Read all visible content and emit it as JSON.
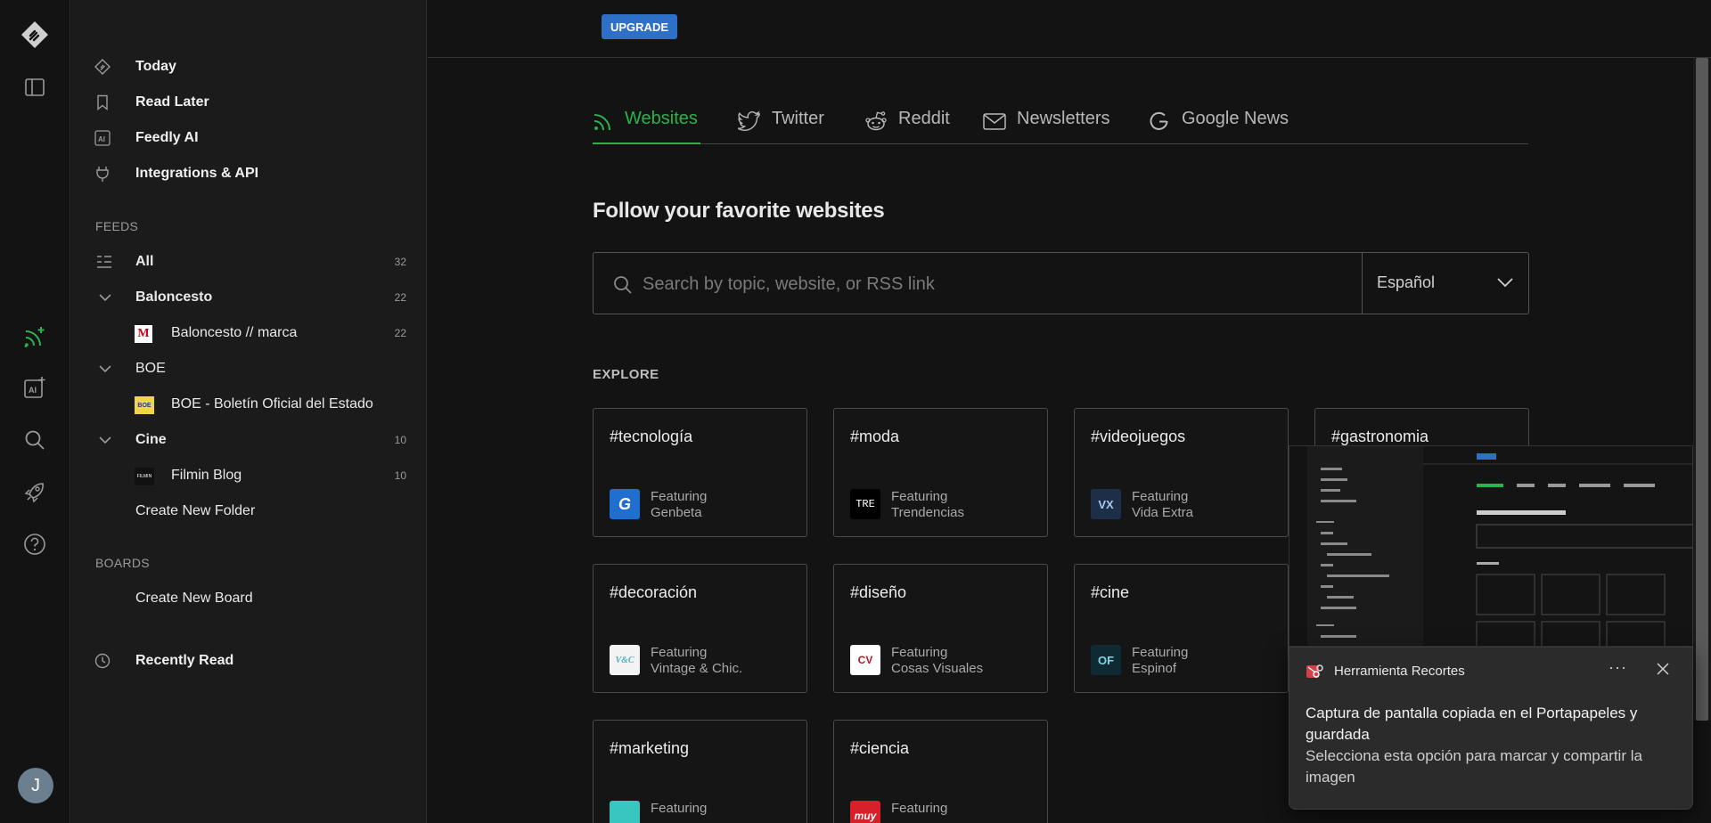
{
  "sidebar": {
    "nav": [
      {
        "label": "Today",
        "icon": "today-icon"
      },
      {
        "label": "Read Later",
        "icon": "bookmark-icon"
      },
      {
        "label": "Feedly AI",
        "icon": "ai-icon"
      },
      {
        "label": "Integrations & API",
        "icon": "plug-icon"
      }
    ],
    "feeds_heading": "FEEDS",
    "all": {
      "label": "All",
      "count": "32"
    },
    "folders": [
      {
        "label": "Baloncesto",
        "count": "22",
        "feed": {
          "label": "Baloncesto // marca",
          "count": "22",
          "icon": "M"
        }
      },
      {
        "label": "BOE",
        "count": "",
        "feed": {
          "label": "BOE - Boletín Oficial del Estado",
          "count": "",
          "icon": "BOE"
        }
      },
      {
        "label": "Cine",
        "count": "10",
        "feed": {
          "label": "Filmin Blog",
          "count": "10",
          "icon": "FILMIN"
        }
      }
    ],
    "create_folder": "Create New Folder",
    "boards_heading": "BOARDS",
    "create_board": "Create New Board",
    "recently_read": "Recently Read"
  },
  "rail": {
    "avatar_letter": "J"
  },
  "topbar": {
    "upgrade": "UPGRADE"
  },
  "tabs": [
    {
      "label": "Websites",
      "icon": "rss-icon",
      "active": true
    },
    {
      "label": "Twitter",
      "icon": "twitter-icon"
    },
    {
      "label": "Reddit",
      "icon": "reddit-icon"
    },
    {
      "label": "Newsletters",
      "icon": "mail-icon"
    },
    {
      "label": "Google News",
      "icon": "google-icon"
    }
  ],
  "heading": "Follow your favorite websites",
  "search": {
    "placeholder": "Search by topic, website, or RSS link",
    "language": "Español"
  },
  "explore_heading": "EXPLORE",
  "cards": [
    {
      "tag": "#tecnología",
      "featuring": "Featuring",
      "site": "Genbeta",
      "logo_text": "G",
      "logo_color": "#1f6fd1"
    },
    {
      "tag": "#moda",
      "featuring": "Featuring",
      "site": "Trendencias",
      "logo_text": "TRE",
      "logo_color": "#000000"
    },
    {
      "tag": "#videojuegos",
      "featuring": "Featuring",
      "site": "Vida Extra",
      "logo_text": "VX",
      "logo_color": "#1d2f48"
    },
    {
      "tag": "#gastronomia",
      "featuring": "",
      "site": "",
      "logo_text": "",
      "logo_color": ""
    },
    {
      "tag": "#decoración",
      "featuring": "Featuring",
      "site": "Vintage & Chic.",
      "logo_text": "V&C",
      "logo_color": "#f3f3f3"
    },
    {
      "tag": "#diseño",
      "featuring": "Featuring",
      "site": "Cosas Visuales",
      "logo_text": "CV",
      "logo_color": "#ffffff"
    },
    {
      "tag": "#cine",
      "featuring": "Featuring",
      "site": "Espinof",
      "logo_text": "OF",
      "logo_color": "#0f2a33"
    },
    {
      "tag": "#marketing",
      "featuring": "Featuring",
      "site": "",
      "logo_text": "",
      "logo_color": "#37c7c0"
    },
    {
      "tag": "#ciencia",
      "featuring": "Featuring",
      "site": "",
      "logo_text": "muy",
      "logo_color": "#d8202a"
    }
  ],
  "toast": {
    "app": "Herramienta Recortes",
    "more": "···",
    "title": "Captura de pantalla copiada en el Portapapeles y guardada",
    "body": "Selecciona esta opción para marcar y compartir la imagen"
  },
  "colors": {
    "accent": "#2bb24c",
    "upgrade": "#2e6fc7",
    "background": "#131313",
    "sidebar": "#1b1b1b"
  }
}
